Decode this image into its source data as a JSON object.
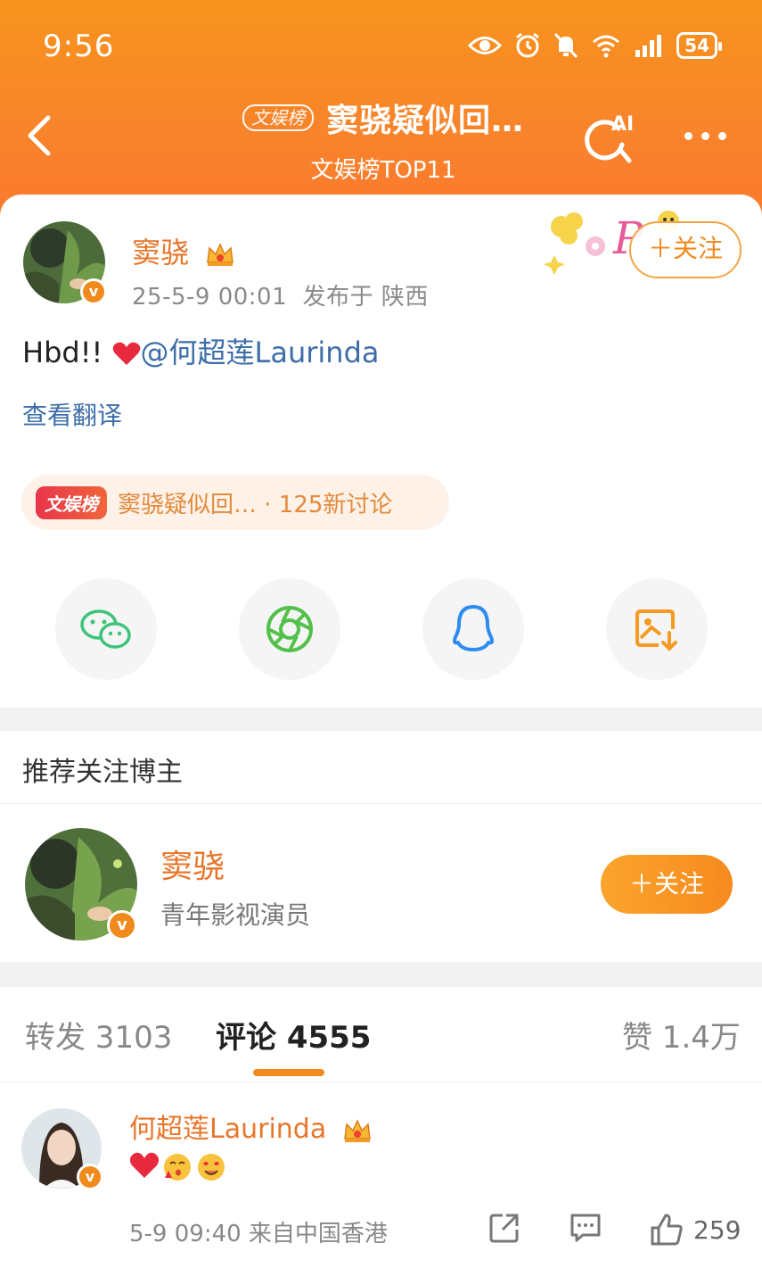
{
  "status_bar": {
    "time": "9:56",
    "battery": "54"
  },
  "navbar": {
    "badge": "文娱榜",
    "title": "窦骁疑似回…",
    "subtitle": "文娱榜TOP11",
    "ai_label": "AI"
  },
  "post": {
    "author": "窦骁",
    "date": "25-5-9 00:01",
    "location": "发布于 陕西",
    "follow_label": "＋关注",
    "text_prefix": "Hbd!! ",
    "mention": "@何超莲Laurinda",
    "translate_label": "查看翻译",
    "topic_badge": "文娱榜",
    "topic_text": "窦骁疑似回… · 125新讨论"
  },
  "share": {
    "icons": [
      "wechat-icon",
      "moments-icon",
      "qq-icon",
      "save-image-icon"
    ]
  },
  "recommend": {
    "title": "推荐关注博主",
    "name": "窦骁",
    "description": "青年影视演员",
    "follow_label": "＋关注"
  },
  "tabs": {
    "repost": "转发 3103",
    "comments": "评论 4555",
    "likes": "赞 1.4万"
  },
  "comment": {
    "author": "何超莲Laurinda",
    "time_location": "5-9 09:40  来自中国香港",
    "like_count": "259"
  },
  "colors": {
    "brand_orange": "#f68a1e",
    "name_orange": "#e8762b",
    "link_blue": "#3d6ea8"
  }
}
